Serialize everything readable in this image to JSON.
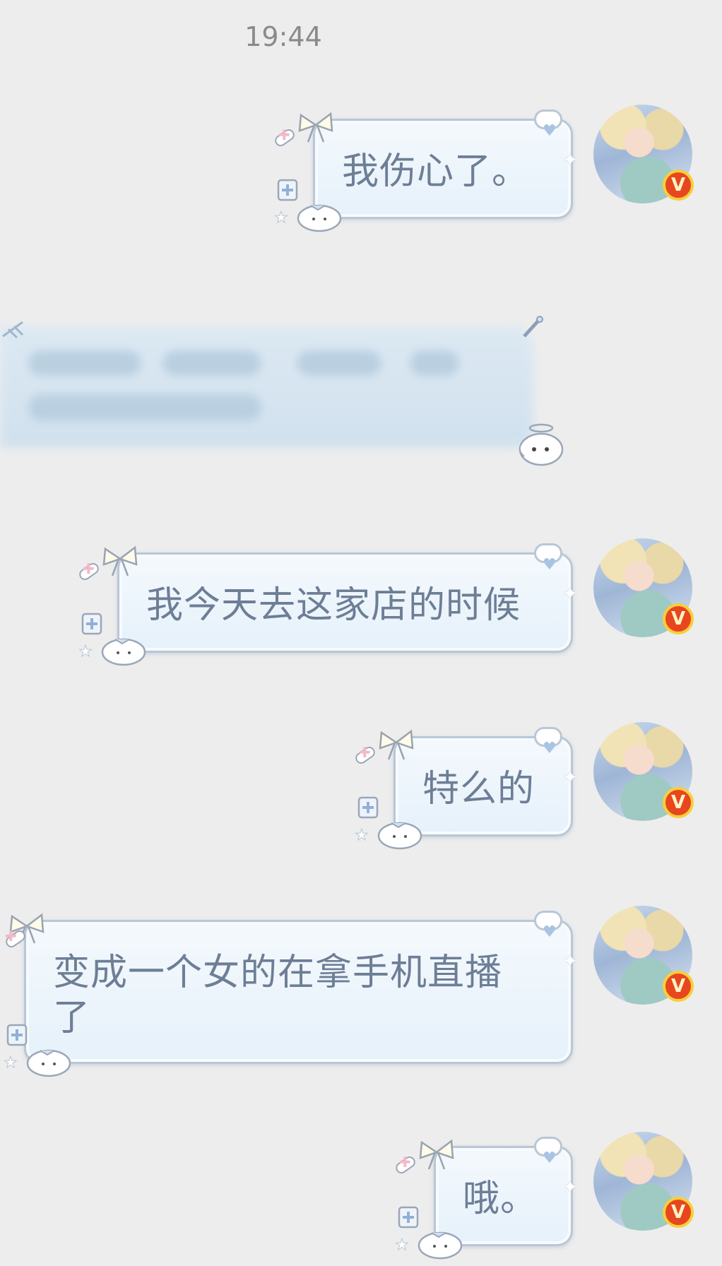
{
  "timestamp": "19:44",
  "messages": [
    {
      "text": "我伤心了。"
    },
    {
      "text": "我今天去这家店的时候"
    },
    {
      "text": "特么的"
    },
    {
      "text": "变成一个女的在拿手机直播了"
    },
    {
      "text": "哦。"
    }
  ],
  "badge": {
    "label": "V",
    "color": "#e8461e",
    "ring": "#f6cf3a"
  },
  "icons": {
    "heart": "heart-icon",
    "bow": "bow-icon",
    "pill": "pill-icon",
    "dog": "dog-icon",
    "star": "star-icon"
  },
  "colors": {
    "background": "#ededed",
    "bubble_text": "#6d7e96",
    "bubble_border": "#b9c7d6"
  }
}
